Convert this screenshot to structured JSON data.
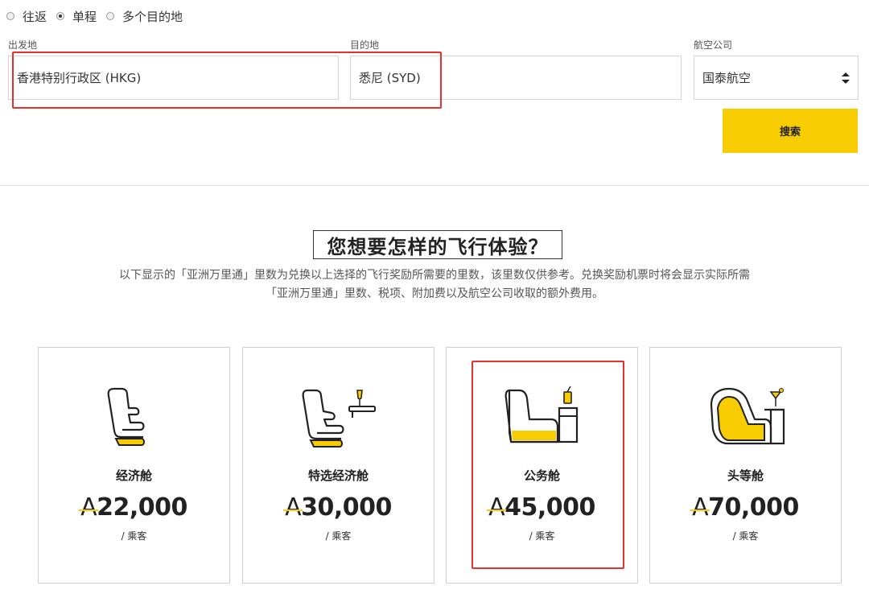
{
  "trip_type": {
    "options": [
      {
        "label": "往返",
        "selected": false
      },
      {
        "label": "单程",
        "selected": true
      },
      {
        "label": "多个目的地",
        "selected": false
      }
    ]
  },
  "form": {
    "origin": {
      "label": "出发地",
      "value": "香港特别行政区 (HKG)"
    },
    "destination": {
      "label": "目的地",
      "value": "悉尼 (SYD)"
    },
    "airline": {
      "label": "航空公司",
      "value": "国泰航空"
    },
    "search_label": "搜索"
  },
  "section": {
    "title": "您想要怎样的飞行体验？",
    "desc_line1": "以下显示的「亚洲万里通」里数为兑换以上选择的飞行奖励所需要的里数，该里数仅供参考。兑换奖励机票时将会显示实际所需",
    "desc_line2": "「亚洲万里通」里数、税项、附加费以及航空公司收取的额外费用。"
  },
  "currency_symbol": "A",
  "cabins": [
    {
      "name": "经济舱",
      "price": "22,000",
      "per": "/ 乘客",
      "icon": "economy-seat-icon"
    },
    {
      "name": "特选经济舱",
      "price": "30,000",
      "per": "/ 乘客",
      "icon": "premium-economy-seat-icon"
    },
    {
      "name": "公务舱",
      "price": "45,000",
      "per": "/ 乘客",
      "icon": "business-seat-icon",
      "highlighted": true
    },
    {
      "name": "头等舱",
      "price": "70,000",
      "per": "/ 乘客",
      "icon": "first-class-seat-icon"
    }
  ],
  "colors": {
    "accent": "#f7cc00",
    "highlight": "#e8302e"
  }
}
